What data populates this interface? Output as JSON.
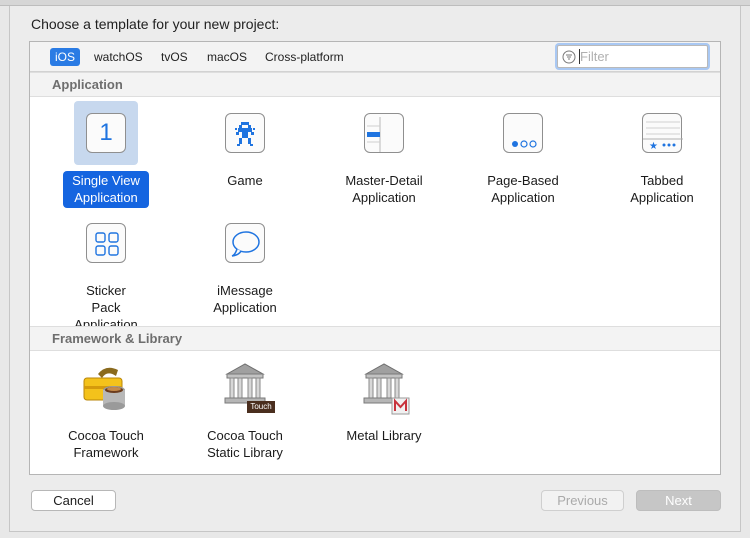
{
  "dialog": {
    "title": "Choose a template for your new project:"
  },
  "tabs": [
    {
      "label": "iOS",
      "active": true
    },
    {
      "label": "watchOS",
      "active": false
    },
    {
      "label": "tvOS",
      "active": false
    },
    {
      "label": "macOS",
      "active": false
    },
    {
      "label": "Cross-platform",
      "active": false
    }
  ],
  "filter": {
    "placeholder": "Filter",
    "value": "",
    "icon": "filter-icon"
  },
  "sections": [
    {
      "title": "Application",
      "items": [
        {
          "label": "Single View Application",
          "icon": "single-view-icon",
          "selected": true
        },
        {
          "label": "Game",
          "icon": "game-icon",
          "selected": false
        },
        {
          "label": "Master-Detail Application",
          "icon": "master-detail-icon",
          "selected": false
        },
        {
          "label": "Page-Based Application",
          "icon": "page-based-icon",
          "selected": false
        },
        {
          "label": "Tabbed Application",
          "icon": "tabbed-icon",
          "selected": false
        },
        {
          "label": "Sticker Pack Application",
          "icon": "sticker-pack-icon",
          "selected": false
        },
        {
          "label": "iMessage Application",
          "icon": "imessage-icon",
          "selected": false
        }
      ]
    },
    {
      "title": "Framework & Library",
      "items": [
        {
          "label": "Cocoa Touch Framework",
          "icon": "toolbox-icon",
          "selected": false
        },
        {
          "label": "Cocoa Touch Static Library",
          "icon": "static-library-icon",
          "badge": "Touch",
          "selected": false
        },
        {
          "label": "Metal Library",
          "icon": "metal-library-icon",
          "selected": false
        }
      ]
    }
  ],
  "icon_text": {
    "single_view_digit": "1"
  },
  "buttons": {
    "cancel": "Cancel",
    "previous": "Previous",
    "next": "Next"
  },
  "colors": {
    "accent": "#1565e0",
    "selection_bg": "#c7d8ee",
    "icon_blue": "#1f74e0"
  }
}
